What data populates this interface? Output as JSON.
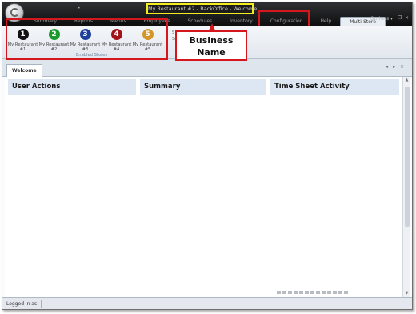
{
  "window": {
    "title": "My Restaurant #2 - BackOffice - Welcome",
    "options_label": "Options ▾"
  },
  "ribbon_tabs": [
    {
      "label": "Summary"
    },
    {
      "label": "Reports"
    },
    {
      "label": "Menus"
    },
    {
      "label": "Employees"
    },
    {
      "label": "Schedules"
    },
    {
      "label": "Inventory"
    },
    {
      "label": "Configuration"
    },
    {
      "label": "Help"
    },
    {
      "label": "Multi-Store",
      "active": true
    }
  ],
  "stores": [
    {
      "number": "1",
      "label": "My Restaurant #1",
      "color": "#111111"
    },
    {
      "number": "2",
      "label": "My Restaurant #2",
      "color": "#1a9a2a"
    },
    {
      "number": "3",
      "label": "My Restaurant #3",
      "color": "#1d3f9c"
    },
    {
      "number": "4",
      "label": "My Restaurant #4",
      "color": "#a3141a"
    },
    {
      "number": "5",
      "label": "My Restaurant #5",
      "color": "#d4962a"
    }
  ],
  "group_label": "Enabled Stores",
  "extra_command": {
    "line1": "S",
    "line2": "Se"
  },
  "callout": {
    "line1": "Business",
    "line2": "Name"
  },
  "document_tab": "Welcome",
  "panels": {
    "user_actions": "User Actions",
    "summary": "Summary",
    "time_sheet": "Time Sheet Activity"
  },
  "status": {
    "text": "Logged in as"
  },
  "colors": {
    "highlight_red": "#d6161d",
    "highlight_yellow": "#f3ec1f"
  }
}
